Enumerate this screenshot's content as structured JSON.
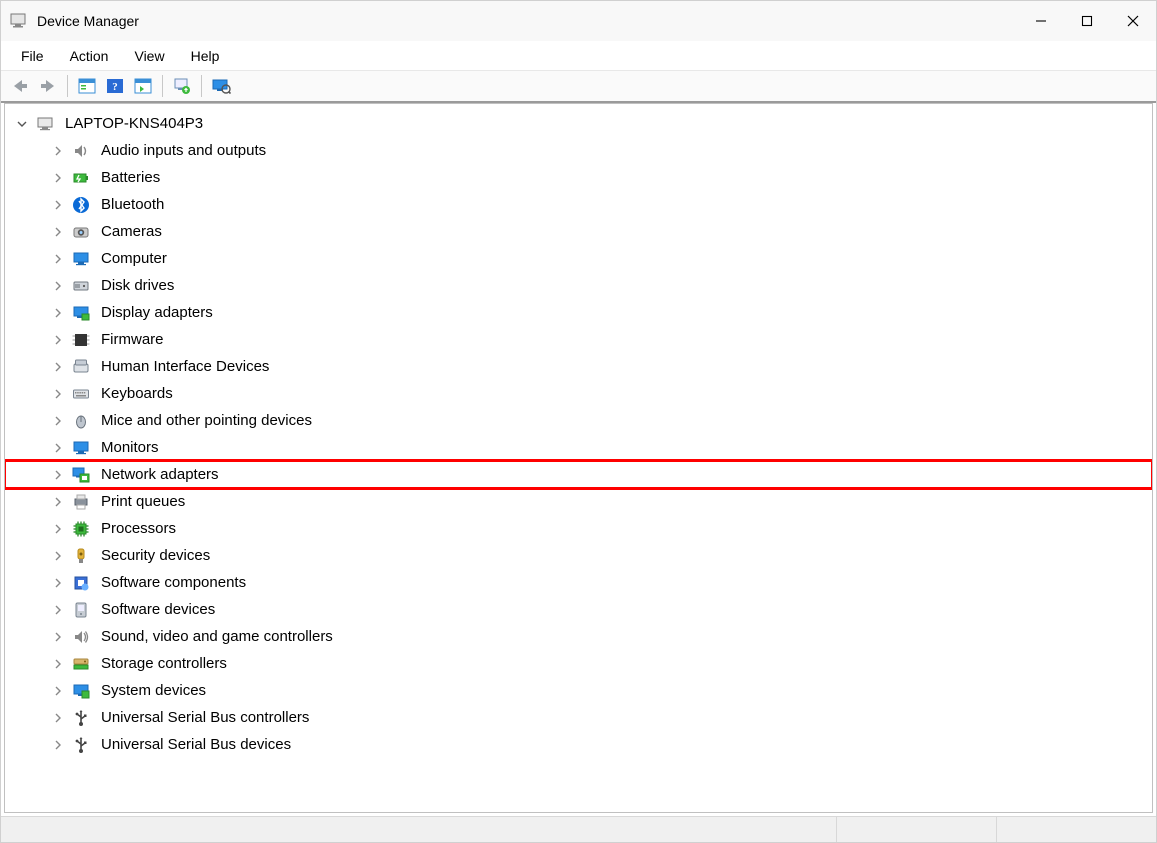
{
  "window": {
    "title": "Device Manager"
  },
  "menubar": {
    "items": [
      "File",
      "Action",
      "View",
      "Help"
    ]
  },
  "toolbar": {
    "buttons": [
      {
        "name": "back-icon"
      },
      {
        "name": "forward-icon"
      },
      {
        "name": "sep"
      },
      {
        "name": "show-hide-console-tree-icon"
      },
      {
        "name": "help-icon"
      },
      {
        "name": "action-pane-icon"
      },
      {
        "name": "sep"
      },
      {
        "name": "scan-hardware-changes-icon"
      },
      {
        "name": "sep"
      },
      {
        "name": "devices-connection-icon"
      }
    ]
  },
  "tree": {
    "root": {
      "label": "LAPTOP-KNS404P3",
      "expanded": true
    },
    "children": [
      {
        "label": "Audio inputs and outputs",
        "icon": "audio-icon",
        "highlighted": false
      },
      {
        "label": "Batteries",
        "icon": "battery-icon",
        "highlighted": false
      },
      {
        "label": "Bluetooth",
        "icon": "bluetooth-icon",
        "highlighted": false
      },
      {
        "label": "Cameras",
        "icon": "camera-icon",
        "highlighted": false
      },
      {
        "label": "Computer",
        "icon": "computer-icon",
        "highlighted": false
      },
      {
        "label": "Disk drives",
        "icon": "disk-icon",
        "highlighted": false
      },
      {
        "label": "Display adapters",
        "icon": "display-adapter-icon",
        "highlighted": false
      },
      {
        "label": "Firmware",
        "icon": "firmware-icon",
        "highlighted": false
      },
      {
        "label": "Human Interface Devices",
        "icon": "hid-icon",
        "highlighted": false
      },
      {
        "label": "Keyboards",
        "icon": "keyboard-icon",
        "highlighted": false
      },
      {
        "label": "Mice and other pointing devices",
        "icon": "mouse-icon",
        "highlighted": false
      },
      {
        "label": "Monitors",
        "icon": "monitor-icon",
        "highlighted": false
      },
      {
        "label": "Network adapters",
        "icon": "network-adapter-icon",
        "highlighted": true
      },
      {
        "label": "Print queues",
        "icon": "printer-icon",
        "highlighted": false
      },
      {
        "label": "Processors",
        "icon": "processor-icon",
        "highlighted": false
      },
      {
        "label": "Security devices",
        "icon": "security-device-icon",
        "highlighted": false
      },
      {
        "label": "Software components",
        "icon": "software-component-icon",
        "highlighted": false
      },
      {
        "label": "Software devices",
        "icon": "software-device-icon",
        "highlighted": false
      },
      {
        "label": "Sound, video and game controllers",
        "icon": "sound-controller-icon",
        "highlighted": false
      },
      {
        "label": "Storage controllers",
        "icon": "storage-controller-icon",
        "highlighted": false
      },
      {
        "label": "System devices",
        "icon": "system-device-icon",
        "highlighted": false
      },
      {
        "label": "Universal Serial Bus controllers",
        "icon": "usb-controller-icon",
        "highlighted": false
      },
      {
        "label": "Universal Serial Bus devices",
        "icon": "usb-device-icon",
        "highlighted": false
      }
    ]
  }
}
